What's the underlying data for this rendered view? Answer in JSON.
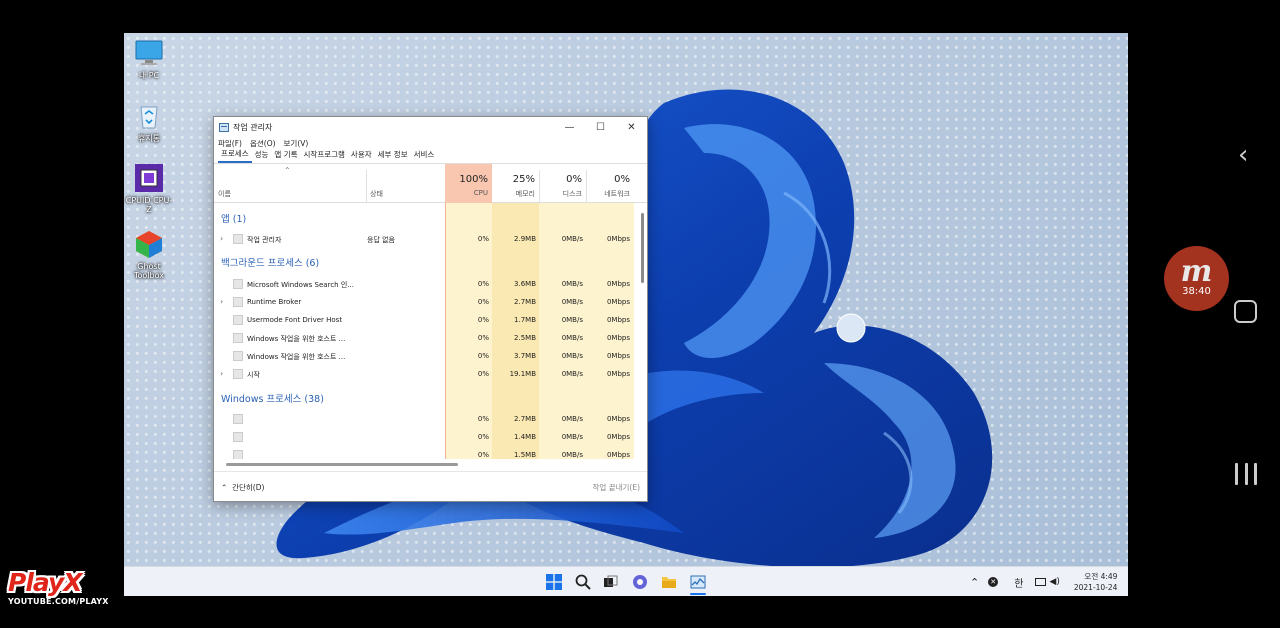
{
  "desktop": {
    "icons": [
      {
        "label": "내 PC"
      },
      {
        "label": "휴지통"
      },
      {
        "label": "CPUID CPU-Z"
      },
      {
        "label": "Ghost Toolbox"
      }
    ]
  },
  "window": {
    "title": "작업 관리자",
    "controls": {
      "minimize": "—",
      "maximize": "☐",
      "close": "✕"
    },
    "menu": [
      "파일(F)",
      "옵션(O)",
      "보기(V)"
    ],
    "tabs": [
      "프로세스",
      "성능",
      "앱 기록",
      "시작프로그램",
      "사용자",
      "세부 정보",
      "서비스"
    ],
    "active_tab": "프로세스",
    "columns": {
      "name": "이름",
      "status": "상태",
      "cpu": {
        "pct": "100%",
        "label": "CPU"
      },
      "memory": {
        "pct": "25%",
        "label": "메모리"
      },
      "disk": {
        "pct": "0%",
        "label": "디스크"
      },
      "network": {
        "pct": "0%",
        "label": "네트워크"
      }
    },
    "groups": {
      "apps": "앱 (1)",
      "background": "백그라운드 프로세스 (6)",
      "windows": "Windows 프로세스 (38)"
    },
    "rows": [
      {
        "expand": "›",
        "name": "작업 관리자",
        "status": "응답 없음",
        "cpu": "0%",
        "mem": "2.9MB",
        "disk": "0MB/s",
        "net": "0Mbps"
      },
      {
        "expand": "",
        "name": "Microsoft Windows Search 인...",
        "status": "",
        "cpu": "0%",
        "mem": "3.6MB",
        "disk": "0MB/s",
        "net": "0Mbps"
      },
      {
        "expand": "›",
        "name": "Runtime Broker",
        "status": "",
        "cpu": "0%",
        "mem": "2.7MB",
        "disk": "0MB/s",
        "net": "0Mbps"
      },
      {
        "expand": "",
        "name": "Usermode Font Driver Host",
        "status": "",
        "cpu": "0%",
        "mem": "1.7MB",
        "disk": "0MB/s",
        "net": "0Mbps"
      },
      {
        "expand": "",
        "name": "Windows 작업을 위한 호스트 ...",
        "status": "",
        "cpu": "0%",
        "mem": "2.5MB",
        "disk": "0MB/s",
        "net": "0Mbps"
      },
      {
        "expand": "",
        "name": "Windows 작업을 위한 호스트 ...",
        "status": "",
        "cpu": "0%",
        "mem": "3.7MB",
        "disk": "0MB/s",
        "net": "0Mbps"
      },
      {
        "expand": "›",
        "name": "시작",
        "status": "",
        "cpu": "0%",
        "mem": "19.1MB",
        "disk": "0MB/s",
        "net": "0Mbps"
      },
      {
        "expand": "",
        "name": "",
        "status": "",
        "cpu": "0%",
        "mem": "2.7MB",
        "disk": "0MB/s",
        "net": "0Mbps"
      },
      {
        "expand": "",
        "name": "",
        "status": "",
        "cpu": "0%",
        "mem": "1.4MB",
        "disk": "0MB/s",
        "net": "0Mbps"
      },
      {
        "expand": "",
        "name": "",
        "status": "",
        "cpu": "0%",
        "mem": "1.5MB",
        "disk": "0MB/s",
        "net": "0Mbps"
      }
    ],
    "footer": {
      "less": "간단히(D)",
      "end_task": "작업 끝내기(E)"
    }
  },
  "taskbar": {
    "apps": [
      "start-icon",
      "search-icon",
      "task-view-icon",
      "chat-icon",
      "file-explorer-icon",
      "task-manager-icon"
    ],
    "tray": {
      "ime": "한",
      "ampm": "오전 4:49",
      "date": "2021-10-24"
    }
  },
  "overlay": {
    "record_time": "38:40",
    "record_letter": "m",
    "brand": "PlayX",
    "brand_sub": "YOUTUBE.COM/PLAYX"
  },
  "colors": {
    "cpu_header": "#f9c7b0",
    "col_tint": "#fdf3cf",
    "col_tint_mem": "#fbe9b3",
    "accent": "#2a6dc9",
    "group_text": "#2d63b5",
    "record_badge": "#a3321f",
    "brand_red": "#e0261b"
  }
}
